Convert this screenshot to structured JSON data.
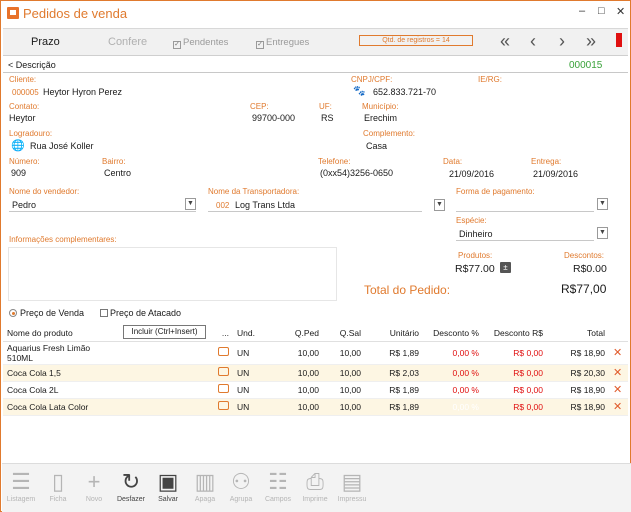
{
  "window": {
    "title": "Pedidos de venda",
    "minimize": "–",
    "maximize": "□",
    "close": "✕"
  },
  "toolbar": {
    "prazo": "Prazo",
    "confere": "Confere",
    "pendentes": "Pendentes",
    "entregues": "Entregues",
    "qtd_registros": "Qtd. de registros = 14"
  },
  "section": {
    "title": "< Descrição",
    "number": "000015"
  },
  "cliente": {
    "label": "Cliente:",
    "code": "000005",
    "name": "Heytor Hyron Perez"
  },
  "cnpj": {
    "label": "CNPJ/CPF:",
    "value": "652.833.721-70"
  },
  "ie": {
    "label": "IE/RG:"
  },
  "contato": {
    "label": "Contato:",
    "value": "Heytor"
  },
  "cep": {
    "label": "CEP:",
    "value": "99700-000"
  },
  "uf": {
    "label": "UF:",
    "value": "RS"
  },
  "municipio": {
    "label": "Município:",
    "value": "Erechim"
  },
  "logradouro": {
    "label": "Logradouro:",
    "value": "Rua José Koller"
  },
  "complemento": {
    "label": "Complemento:",
    "value": "Casa"
  },
  "numero": {
    "label": "Número:",
    "value": "909"
  },
  "bairro": {
    "label": "Bairro:",
    "value": "Centro"
  },
  "telefone": {
    "label": "Telefone:",
    "value": "(0xx54)3256-0650"
  },
  "data": {
    "label": "Data:",
    "value": "21/09/2016"
  },
  "entrega": {
    "label": "Entrega:",
    "value": "21/09/2016"
  },
  "vendedor": {
    "label": "Nome do vendedor:",
    "value": "Pedro"
  },
  "transportadora": {
    "label": "Nome da Transportadora:",
    "code": "002",
    "value": "Log Trans Ltda"
  },
  "forma_pagamento": {
    "label": "Forma de pagamento:",
    "value": ""
  },
  "especie": {
    "label": "Espécie:",
    "value": "Dinheiro"
  },
  "info": {
    "label": "Informações complementares:"
  },
  "produtos": {
    "label": "Produtos:",
    "value": "R$77.00"
  },
  "descontos": {
    "label": "Descontos:",
    "value": "R$0.00"
  },
  "total": {
    "label": "Total do Pedido:",
    "value": "R$77,00"
  },
  "preco": {
    "venda": "Preço de Venda",
    "atacado": "Preço de Atacado"
  },
  "tooltip": "Incluir (Ctrl+Insert)",
  "grid": {
    "headers": [
      "Nome do produto",
      "...",
      "Und.",
      "Q.Ped",
      "Q.Sal",
      "Unitário",
      "Desconto %",
      "Desconto R$",
      "Total"
    ],
    "rows": [
      {
        "nome": "Aquarius Fresh Limão 510ML",
        "und": "UN",
        "qped": "10,00",
        "qsal": "10,00",
        "unit": "R$ 1,89",
        "descp": "0,00 %",
        "descr": "R$ 0,00",
        "total": "R$ 18,90"
      },
      {
        "nome": "Coca Cola 1,5",
        "und": "UN",
        "qped": "10,00",
        "qsal": "10,00",
        "unit": "R$ 2,03",
        "descp": "0,00 %",
        "descr": "R$ 0,00",
        "total": "R$ 20,30"
      },
      {
        "nome": "Coca Cola 2L",
        "und": "UN",
        "qped": "10,00",
        "qsal": "10,00",
        "unit": "R$ 1,89",
        "descp": "0,00 %",
        "descr": "R$ 0,00",
        "total": "R$ 18,90"
      },
      {
        "nome": "Coca Cola Lata Color",
        "und": "UN",
        "qped": "10,00",
        "qsal": "10,00",
        "unit": "R$ 1,89",
        "descp": "0,00 %",
        "descr": "R$ 0,00",
        "total": "R$ 18,90"
      }
    ]
  },
  "bottom": [
    "Listagem",
    "Ficha",
    "Novo",
    "Desfazer",
    "Salvar",
    "Apaga",
    "Agrupa",
    "Campos",
    "Imprime",
    "Impressu"
  ],
  "colors": {
    "accent": "#e07a2e",
    "negative": "#e01010",
    "selection": "#2d8fdc"
  }
}
